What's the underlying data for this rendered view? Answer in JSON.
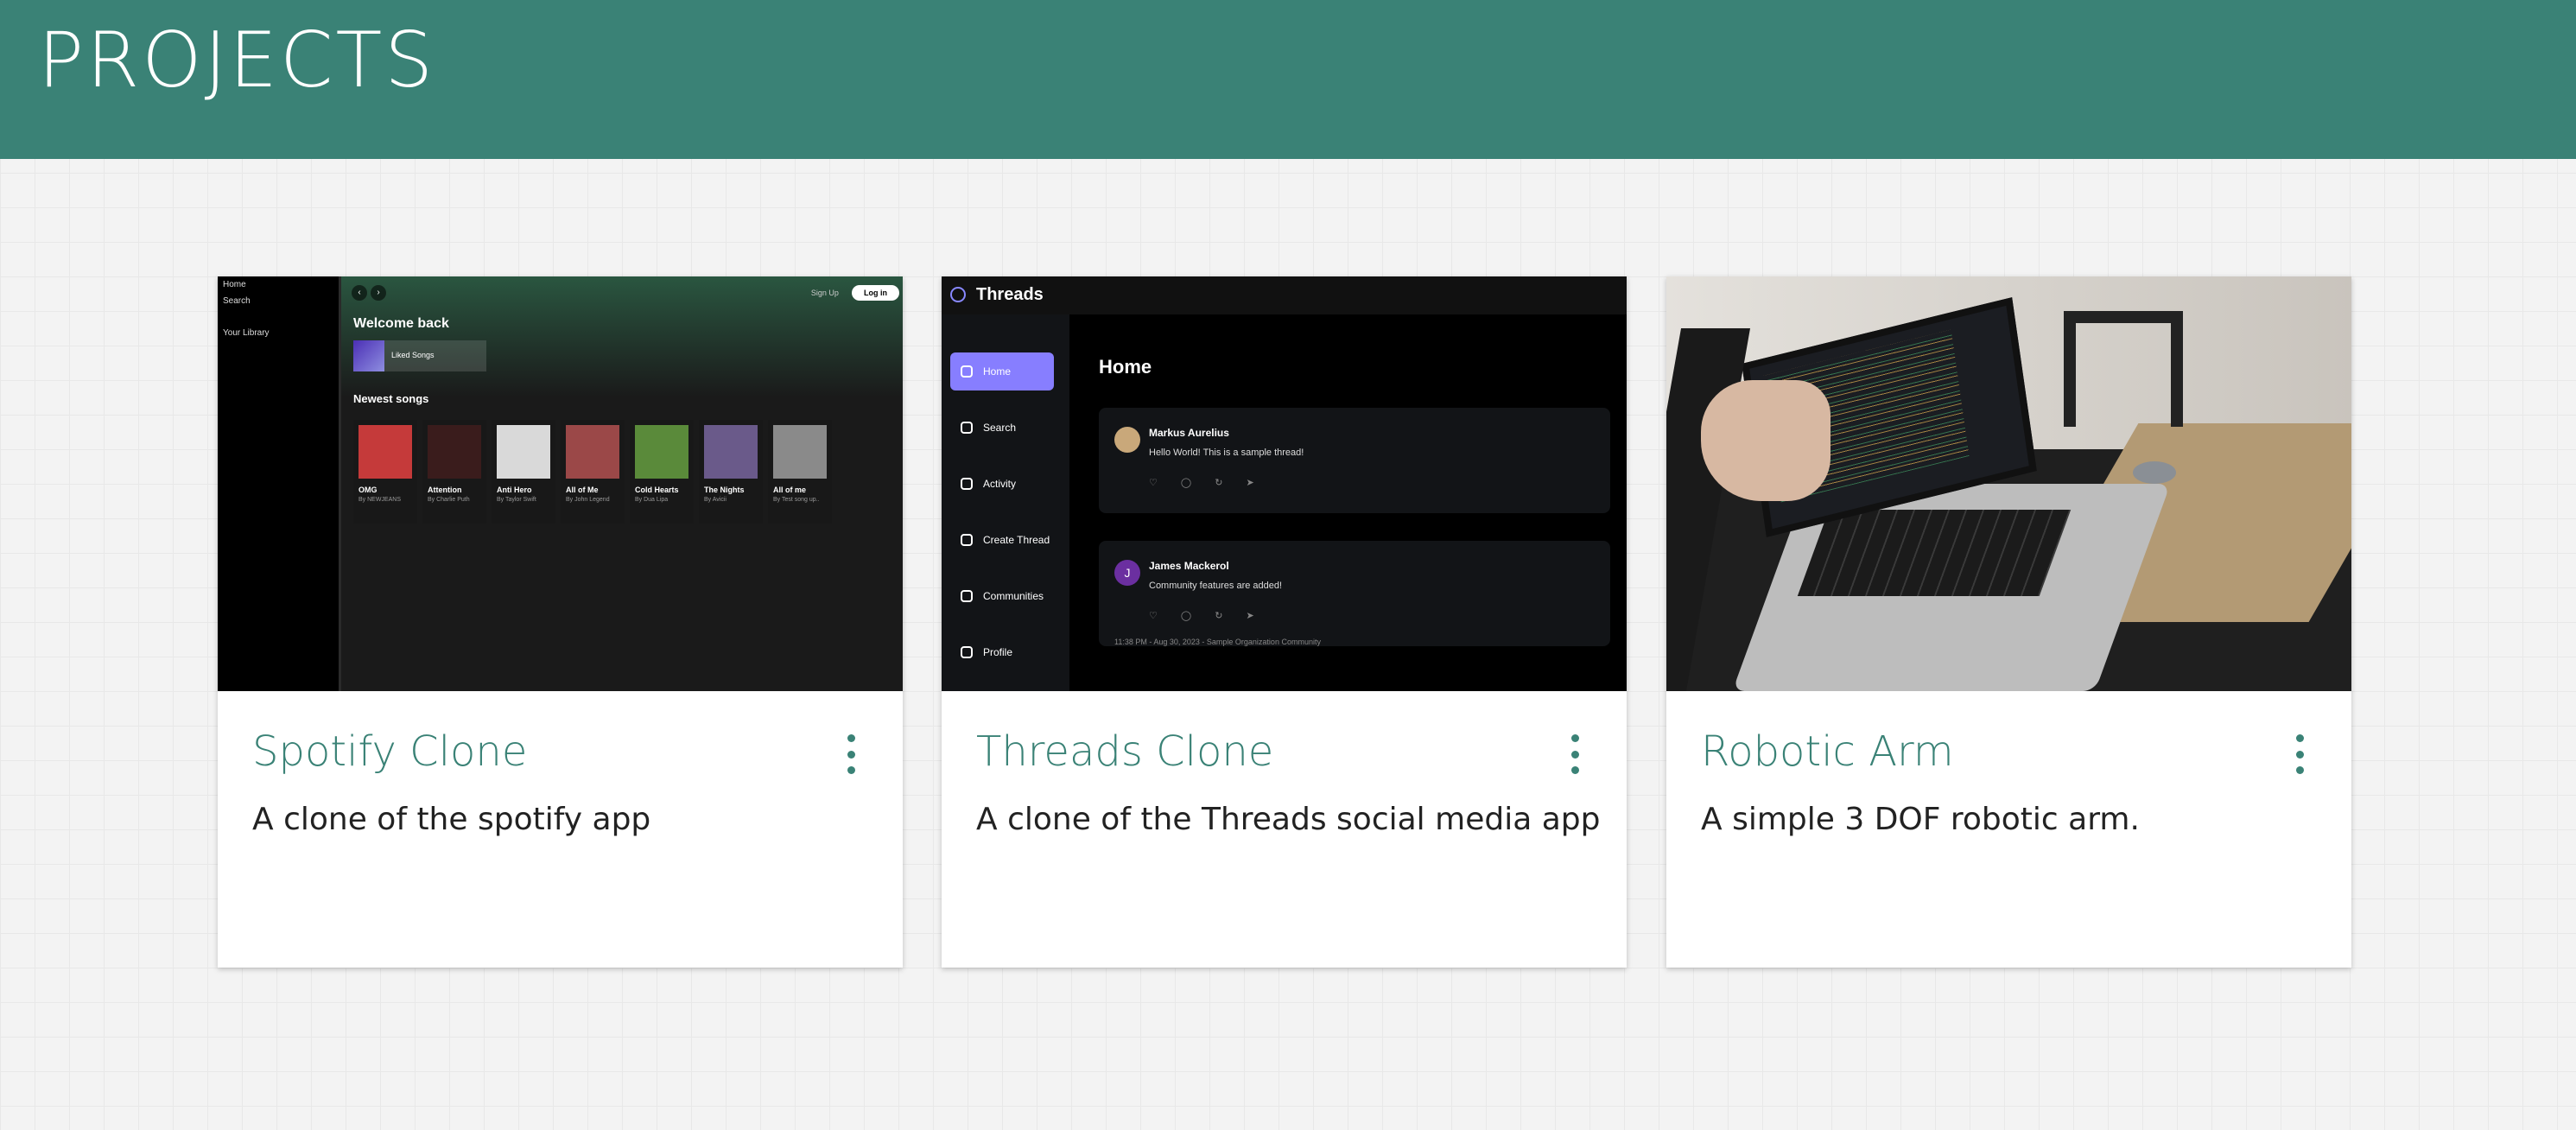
{
  "header": {
    "title": "PROJECTS"
  },
  "projects": [
    {
      "title": "Spotify Clone",
      "description": "A clone of the spotify app",
      "preview": {
        "side_items": [
          "Home",
          "Search",
          "Your Library"
        ],
        "signup": "Sign Up",
        "login": "Log in",
        "welcome": "Welcome back",
        "liked": "Liked Songs",
        "newest": "Newest songs",
        "songs": [
          {
            "name": "OMG",
            "artist": "By NEWJEANS",
            "color": "#c53a3a"
          },
          {
            "name": "Attention",
            "artist": "By Charlie Puth",
            "color": "#3a1c1c"
          },
          {
            "name": "Anti Hero",
            "artist": "By Taylor Swift",
            "color": "#d9d9d9"
          },
          {
            "name": "All of Me",
            "artist": "By John Legend",
            "color": "#9b4848"
          },
          {
            "name": "Cold Hearts",
            "artist": "By Dua Lipa",
            "color": "#5a8a3a"
          },
          {
            "name": "The Nights",
            "artist": "By Avicii",
            "color": "#6a5a8a"
          },
          {
            "name": "All of me",
            "artist": "By Test song up..",
            "color": "#8a8a8a"
          }
        ]
      }
    },
    {
      "title": "Threads Clone",
      "description": "A clone of the Threads social media app",
      "preview": {
        "brand": "Threads",
        "nav": [
          "Home",
          "Search",
          "Activity",
          "Create Thread",
          "Communities",
          "Profile"
        ],
        "heading": "Home",
        "posts": [
          {
            "author": "Markus Aurelius",
            "text": "Hello World! This is a sample thread!",
            "initial": "",
            "avatar_color": "#c9a87a",
            "meta": ""
          },
          {
            "author": "James Mackerol",
            "text": "Community features are added!",
            "initial": "J",
            "avatar_color": "#6b2fa0",
            "meta": "11:38 PM - Aug 30, 2023 - Sample Organization Community"
          }
        ],
        "actions": "♡ ◯ ↻ ➤"
      }
    },
    {
      "title": "Robotic Arm",
      "description": "A simple 3 DOF robotic arm."
    }
  ],
  "icons": {
    "more": "more-vert-icon"
  },
  "colors": {
    "accent": "#3a8276"
  }
}
